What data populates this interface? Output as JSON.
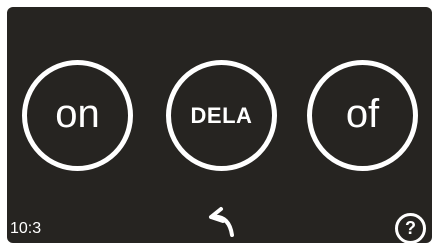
{
  "buttons": {
    "left_label": "on",
    "middle_label": "DELA",
    "right_label": "of"
  },
  "status": {
    "time": "10:3"
  },
  "controls": {
    "back_icon": "back-arrow-icon",
    "help_label": "?"
  },
  "colors": {
    "background": "#262421",
    "foreground": "#ffffff"
  }
}
